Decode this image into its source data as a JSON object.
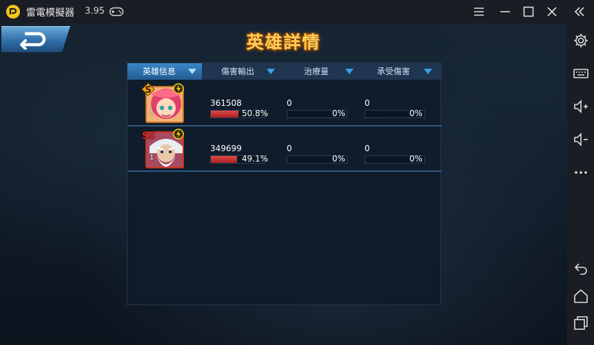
{
  "window": {
    "app_title": "雷電模擬器",
    "version": "3.95"
  },
  "game": {
    "title": "英雄詳情",
    "columns": {
      "hero": "英雄信息",
      "damage": "傷害輸出",
      "heal": "治療量",
      "taken": "承受傷害"
    },
    "heroes": [
      {
        "rank": "S",
        "level": "1",
        "damage": "361508",
        "damage_pct": "50.8%",
        "damage_fraction": 0.508,
        "heal": "0",
        "heal_pct": "0%",
        "taken": "0",
        "taken_pct": "0%"
      },
      {
        "rank": "SS",
        "level": "1",
        "damage": "349699",
        "damage_pct": "49.1%",
        "damage_fraction": 0.491,
        "heal": "0",
        "heal_pct": "0%",
        "taken": "0",
        "taken_pct": "0%"
      }
    ]
  },
  "icons": {
    "logo": "ldplayer-logo-icon",
    "gamepad": "gamepad-icon",
    "sidebar": [
      "gear-icon",
      "keyboard-icon",
      "volume-up-icon",
      "volume-down-icon",
      "more-icon",
      "back-icon",
      "home-icon",
      "recent-apps-icon"
    ]
  },
  "colors": {
    "accent_blue": "#39a5e6",
    "title_gold": "#ffce5a",
    "damage_red": "#d63a3a"
  }
}
